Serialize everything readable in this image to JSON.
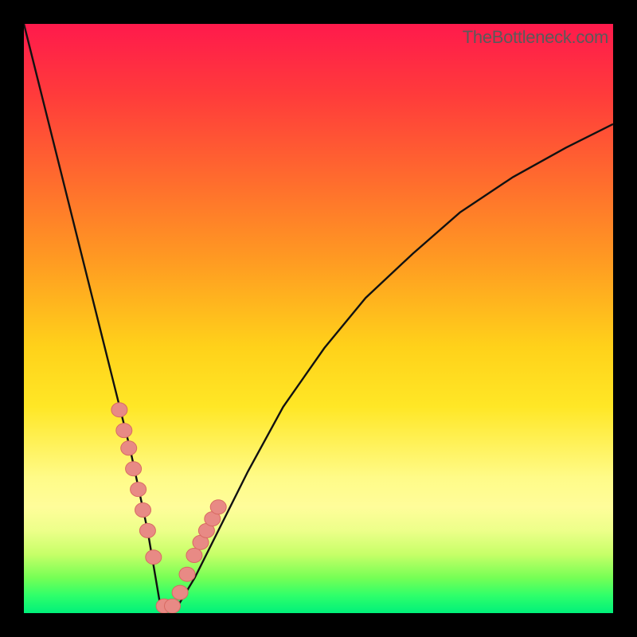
{
  "watermark_text": "TheBottleneck.com",
  "chart_data": {
    "type": "line",
    "title": "",
    "xlabel": "",
    "ylabel": "",
    "xlim": [
      0,
      1
    ],
    "ylim": [
      0,
      1
    ],
    "background_gradient_semantics": "vertical red (high) → yellow → green (low) performance score",
    "series": [
      {
        "name": "bottleneck-curve",
        "x": [
          0.0,
          0.03,
          0.06,
          0.09,
          0.12,
          0.15,
          0.18,
          0.21,
          0.232,
          0.26,
          0.29,
          0.33,
          0.38,
          0.44,
          0.51,
          0.58,
          0.66,
          0.74,
          0.83,
          0.92,
          1.0
        ],
        "values": [
          1.0,
          0.88,
          0.76,
          0.64,
          0.52,
          0.4,
          0.28,
          0.14,
          0.01,
          0.01,
          0.06,
          0.14,
          0.24,
          0.35,
          0.45,
          0.535,
          0.61,
          0.68,
          0.74,
          0.79,
          0.83
        ]
      }
    ],
    "markers": {
      "name": "highlighted-range-points",
      "note": "salmon dots near the trough on both branches",
      "x": [
        0.162,
        0.17,
        0.178,
        0.186,
        0.194,
        0.202,
        0.21,
        0.22,
        0.238,
        0.252,
        0.265,
        0.277,
        0.289,
        0.3,
        0.31,
        0.32,
        0.33
      ],
      "values": [
        0.345,
        0.31,
        0.28,
        0.245,
        0.21,
        0.175,
        0.14,
        0.095,
        0.012,
        0.012,
        0.035,
        0.066,
        0.098,
        0.12,
        0.14,
        0.16,
        0.18
      ]
    }
  },
  "colors": {
    "curve": "#111111",
    "marker_fill": "#e88a85",
    "marker_stroke": "#d86a62"
  }
}
